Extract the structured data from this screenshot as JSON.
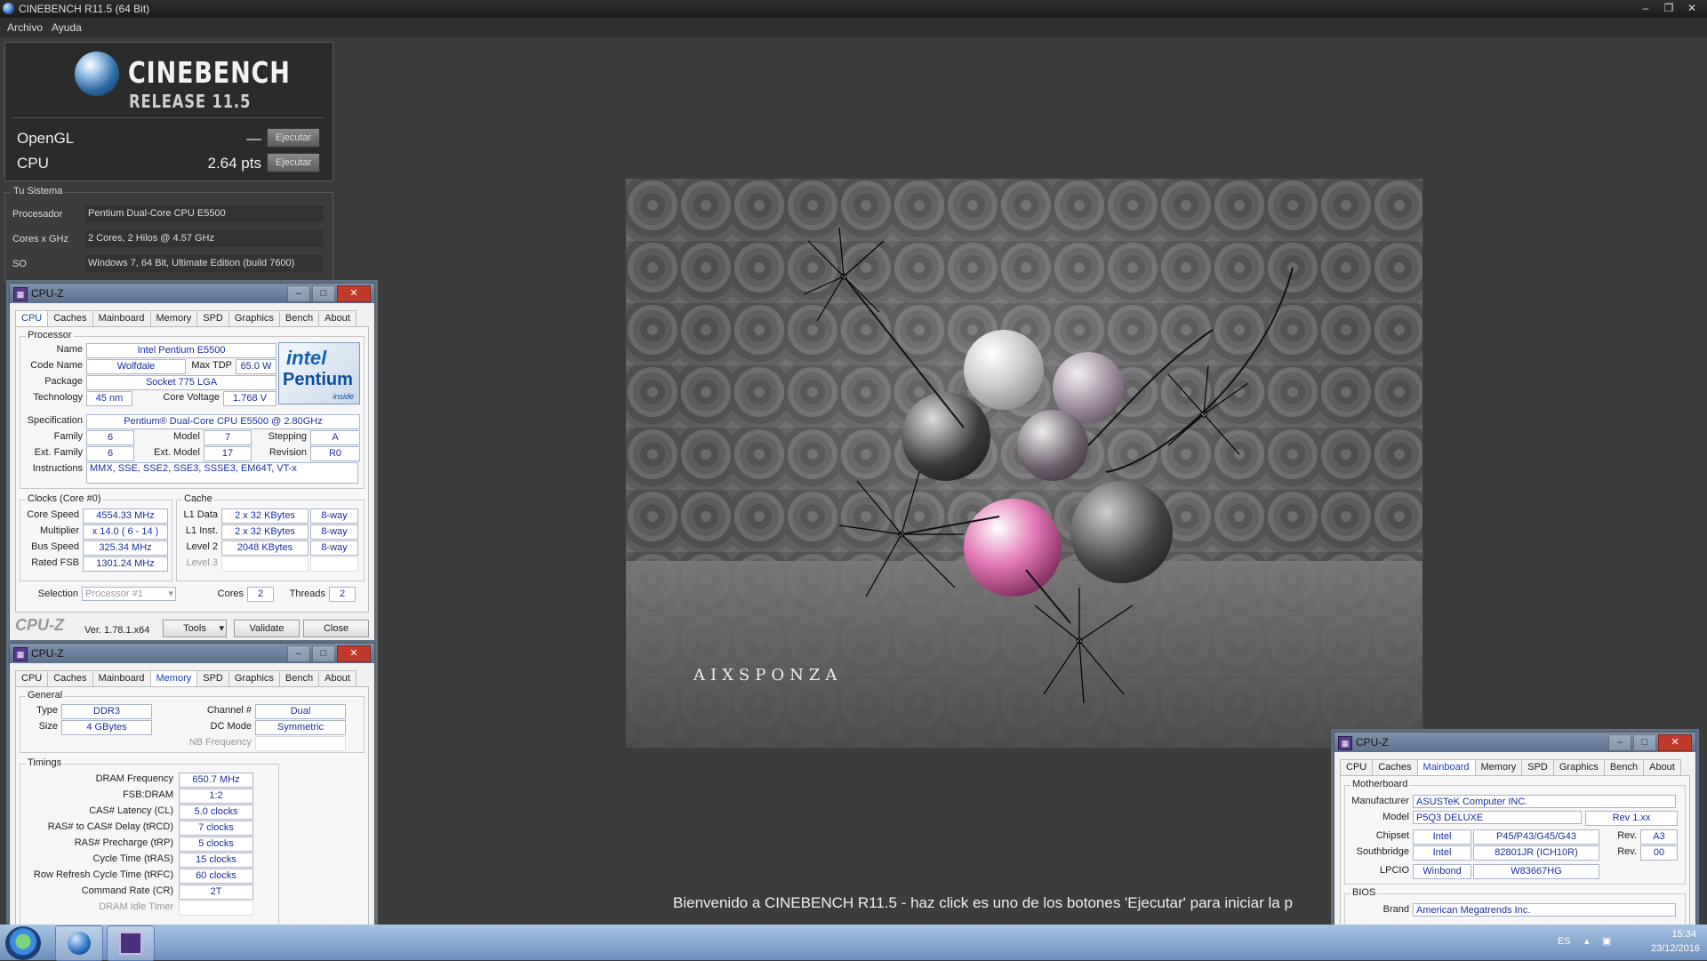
{
  "cinebench": {
    "window_title": "CINEBENCH R11.5 (64 Bit)",
    "menu": [
      "Archivo",
      "Ayuda"
    ],
    "logo_word": "CINEBENCH",
    "logo_release": "RELEASE 11.5",
    "opengl": {
      "label": "OpenGL",
      "value": "—",
      "button": "Ejecutar"
    },
    "cpu": {
      "label": "CPU",
      "value": "2.64 pts",
      "button": "Ejecutar"
    },
    "system_group": "Tu Sistema",
    "system": [
      {
        "key": "Procesador",
        "value": "Pentium Dual-Core CPU E5500"
      },
      {
        "key": "Cores x GHz",
        "value": "2 Cores, 2 Hilos @ 4.57 GHz"
      },
      {
        "key": "SO",
        "value": "Windows 7, 64 Bit, Ultimate Edition (build 7600)"
      }
    ],
    "render_brand": "AIXSPONZA",
    "welcome": "Bienvenido a CINEBENCH R11.5 - haz click es uno de los botones 'Ejecutar' para iniciar la p"
  },
  "cpuz_common": {
    "title": "CPU-Z",
    "tabs": [
      "CPU",
      "Caches",
      "Mainboard",
      "Memory",
      "SPD",
      "Graphics",
      "Bench",
      "About"
    ]
  },
  "cpuz_cpu": {
    "processor_group": "Processor",
    "name_label": "Name",
    "name": "Intel Pentium E5500",
    "codename_label": "Code Name",
    "codename": "Wolfdale",
    "maxtdp_label": "Max TDP",
    "maxtdp": "65.0 W",
    "package_label": "Package",
    "package": "Socket 775 LGA",
    "technology_label": "Technology",
    "technology": "45 nm",
    "corevoltage_label": "Core Voltage",
    "corevoltage": "1.768 V",
    "spec_label": "Specification",
    "spec": "Pentium® Dual-Core  CPU     E5500  @ 2.80GHz",
    "family_label": "Family",
    "family": "6",
    "model_label": "Model",
    "model": "7",
    "stepping_label": "Stepping",
    "stepping": "A",
    "extfamily_label": "Ext. Family",
    "extfamily": "6",
    "extmodel_label": "Ext. Model",
    "extmodel": "17",
    "revision_label": "Revision",
    "revision": "R0",
    "instructions_label": "Instructions",
    "instructions": "MMX, SSE, SSE2, SSE3, SSSE3, EM64T, VT-x",
    "intel_logo": {
      "brand": "intel",
      "product": "Pentium",
      "tag": "inside"
    },
    "clocks_group": "Clocks (Core #0)",
    "corespeed_label": "Core Speed",
    "corespeed": "4554.33 MHz",
    "multiplier_label": "Multiplier",
    "multiplier": "x 14.0 ( 6 - 14 )",
    "busspeed_label": "Bus Speed",
    "busspeed": "325.34 MHz",
    "ratedfsb_label": "Rated FSB",
    "ratedfsb": "1301.24 MHz",
    "cache_group": "Cache",
    "l1data_label": "L1 Data",
    "l1data": "2 x 32 KBytes",
    "l1data_way": "8-way",
    "l1inst_label": "L1 Inst.",
    "l1inst": "2 x 32 KBytes",
    "l1inst_way": "8-way",
    "level2_label": "Level 2",
    "level2": "2048 KBytes",
    "level2_way": "8-way",
    "level3_label": "Level 3",
    "selection_label": "Selection",
    "selection": "Processor #1",
    "cores_label": "Cores",
    "cores": "2",
    "threads_label": "Threads",
    "threads": "2",
    "footer_logo": "CPU-Z",
    "version": "Ver. 1.78.1.x64",
    "tools": "Tools",
    "validate": "Validate",
    "close": "Close"
  },
  "cpuz_mem": {
    "general_group": "General",
    "type_label": "Type",
    "type": "DDR3",
    "channel_label": "Channel #",
    "channel": "Dual",
    "size_label": "Size",
    "size": "4 GBytes",
    "dcmode_label": "DC Mode",
    "dcmode": "Symmetric",
    "nbfreq_label": "NB Frequency",
    "timings_group": "Timings",
    "timings": [
      {
        "label": "DRAM Frequency",
        "value": "650.7 MHz"
      },
      {
        "label": "FSB:DRAM",
        "value": "1:2"
      },
      {
        "label": "CAS# Latency (CL)",
        "value": "5.0 clocks"
      },
      {
        "label": "RAS# to CAS# Delay (tRCD)",
        "value": "7 clocks"
      },
      {
        "label": "RAS# Precharge (tRP)",
        "value": "5 clocks"
      },
      {
        "label": "Cycle Time (tRAS)",
        "value": "15 clocks"
      },
      {
        "label": "Row Refresh Cycle Time (tRFC)",
        "value": "60 clocks"
      },
      {
        "label": "Command Rate (CR)",
        "value": "2T"
      }
    ],
    "idle_timer_label": "DRAM Idle Timer"
  },
  "cpuz_mb": {
    "motherboard_group": "Motherboard",
    "manufacturer_label": "Manufacturer",
    "manufacturer": "ASUSTeK Computer INC.",
    "model_label": "Model",
    "model": "P5Q3 DELUXE",
    "model_rev": "Rev 1.xx",
    "chipset_label": "Chipset",
    "chipset_vendor": "Intel",
    "chipset": "P45/P43/G45/G43",
    "chipset_rev_label": "Rev.",
    "chipset_rev": "A3",
    "southbridge_label": "Southbridge",
    "southbridge_vendor": "Intel",
    "southbridge": "82801JR (ICH10R)",
    "southbridge_rev_label": "Rev.",
    "southbridge_rev": "00",
    "lpcio_label": "LPCIO",
    "lpcio_vendor": "Winbond",
    "lpcio": "W83667HG",
    "bios_group": "BIOS",
    "brand_label": "Brand",
    "brand": "American Megatrends Inc."
  },
  "taskbar": {
    "language": "ES",
    "time": "15:34",
    "date": "23/12/2016"
  }
}
